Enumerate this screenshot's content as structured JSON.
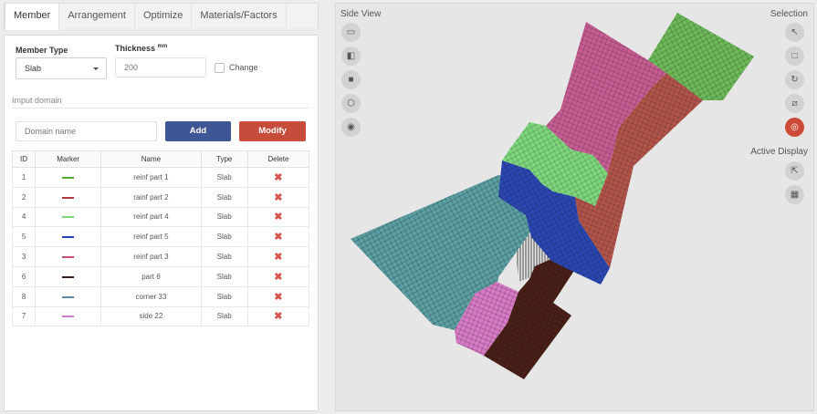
{
  "tabs": [
    "Member",
    "Arrangement",
    "Optimize",
    "Materials/Factors"
  ],
  "active_tab": "Member",
  "member_type": {
    "label": "Member Type",
    "value": "Slab"
  },
  "thickness": {
    "label": "Thickness",
    "unit": "mm",
    "placeholder": "200"
  },
  "change_label": "Change",
  "input_domain": {
    "section": "Imput domain",
    "placeholder": "Domain name",
    "add_label": "Add",
    "modify_label": "Modify"
  },
  "table": {
    "headers": [
      "ID",
      "Marker",
      "Name",
      "Type",
      "Delete"
    ],
    "rows": [
      {
        "id": "1",
        "color": "#58a93a",
        "name": "reinf part 1",
        "type": "Slab"
      },
      {
        "id": "2",
        "color": "#b03a3a",
        "name": "rainf part 2",
        "type": "Slab"
      },
      {
        "id": "4",
        "color": "#7ed87a",
        "name": "reinf part 4",
        "type": "Slab"
      },
      {
        "id": "5",
        "color": "#2344b5",
        "name": "reinf part 5",
        "type": "Slab"
      },
      {
        "id": "3",
        "color": "#c2507e",
        "name": "reinf part 3",
        "type": "Slab"
      },
      {
        "id": "6",
        "color": "#3a1a14",
        "name": "part 6",
        "type": "Slab"
      },
      {
        "id": "8",
        "color": "#5a8ca6",
        "name": "corner 33",
        "type": "Slab"
      },
      {
        "id": "7",
        "color": "#cc7dcc",
        "name": "side 22",
        "type": "Slab"
      }
    ],
    "delete_icon": "✖"
  },
  "view": {
    "side_view_label": "Side View",
    "selection_label": "Selection",
    "active_display_label": "Active Display"
  }
}
